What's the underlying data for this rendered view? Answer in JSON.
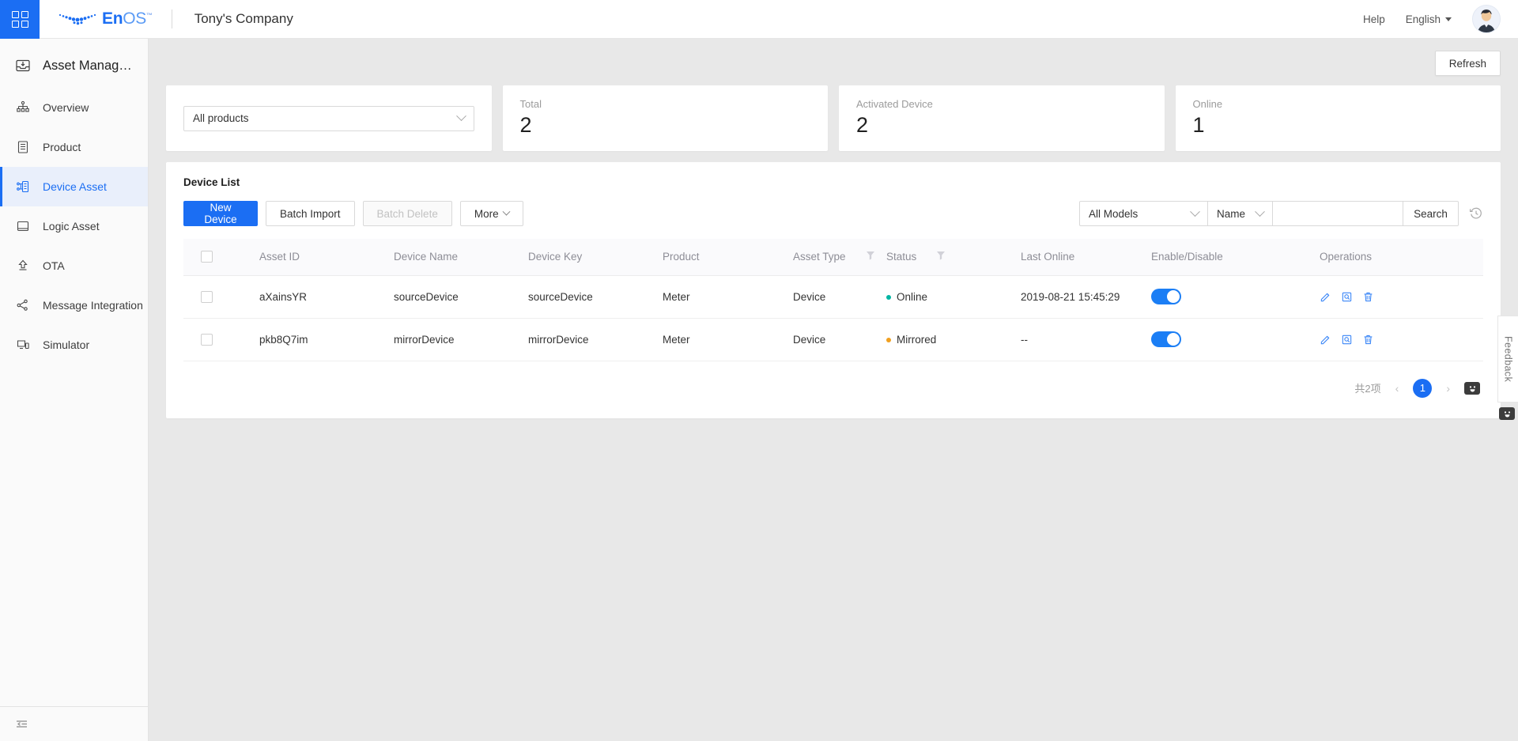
{
  "header": {
    "grid_icon": "grid-apps-icon",
    "logo_en": "En",
    "logo_os": "OS",
    "logo_tm": "™",
    "company": "Tony's Company",
    "help": "Help",
    "language": "English",
    "avatar_icon": "user-avatar-icon"
  },
  "sidebar": {
    "title": "Asset Manag…",
    "title_icon": "asset-inbox-icon",
    "items": [
      {
        "label": "Overview",
        "icon": "hierarchy-icon",
        "active": false
      },
      {
        "label": "Product",
        "icon": "document-list-icon",
        "active": false
      },
      {
        "label": "Device Asset",
        "icon": "device-node-icon",
        "active": true
      },
      {
        "label": "Logic Asset",
        "icon": "book-icon",
        "active": false
      },
      {
        "label": "OTA",
        "icon": "upload-arrow-icon",
        "active": false
      },
      {
        "label": "Message Integration",
        "icon": "share-nodes-icon",
        "active": false
      },
      {
        "label": "Simulator",
        "icon": "monitor-icon",
        "active": false
      }
    ],
    "collapse_icon": "collapse-sidebar-icon"
  },
  "main": {
    "refresh_label": "Refresh",
    "product_filter": {
      "value": "All products",
      "icon": "chevron-down-icon"
    },
    "stats": [
      {
        "label": "Total",
        "value": "2"
      },
      {
        "label": "Activated Device",
        "value": "2"
      },
      {
        "label": "Online",
        "value": "1"
      }
    ],
    "panel_title": "Device List",
    "toolbar": {
      "new_device": "New Device",
      "batch_import": "Batch Import",
      "batch_delete": "Batch Delete",
      "more": "More",
      "more_icon": "chevron-down-icon",
      "models_filter": "All Models",
      "field_filter": "Name",
      "search_value": "",
      "search_placeholder": "",
      "search_button": "Search",
      "history_icon": "history-clock-icon"
    },
    "table": {
      "columns": [
        "Asset ID",
        "Device Name",
        "Device Key",
        "Product",
        "Asset Type",
        "Status",
        "Last Online",
        "Enable/Disable",
        "Operations"
      ],
      "filter_icon": "funnel-filter-icon",
      "rows": [
        {
          "checked": false,
          "asset_id": "aXainsYR",
          "device_name": "sourceDevice",
          "device_key": "sourceDevice",
          "product": "Meter",
          "asset_type": "Device",
          "status": "Online",
          "status_color": "#00b5a3",
          "last_online": "2019-08-21 15:45:29",
          "enabled": true,
          "ops": [
            "edit-icon",
            "view-detail-icon",
            "delete-icon"
          ]
        },
        {
          "checked": false,
          "asset_id": "pkb8Q7im",
          "device_name": "mirrorDevice",
          "device_key": "mirrorDevice",
          "product": "Meter",
          "asset_type": "Device",
          "status": "Mirrored",
          "status_color": "#f0a020",
          "last_online": "--",
          "enabled": true,
          "ops": [
            "edit-icon",
            "view-detail-icon",
            "delete-icon"
          ]
        }
      ]
    },
    "pagination": {
      "total_text": "共2项",
      "prev": "‹",
      "current_page": "1",
      "next": "›",
      "face_icon": "smiley-face-icon"
    }
  },
  "feedback": {
    "label": "Feedback",
    "face_icon": "smiley-face-icon"
  },
  "colors": {
    "accent": "#1b6ef3",
    "online": "#00b5a3",
    "mirrored": "#f0a020"
  }
}
